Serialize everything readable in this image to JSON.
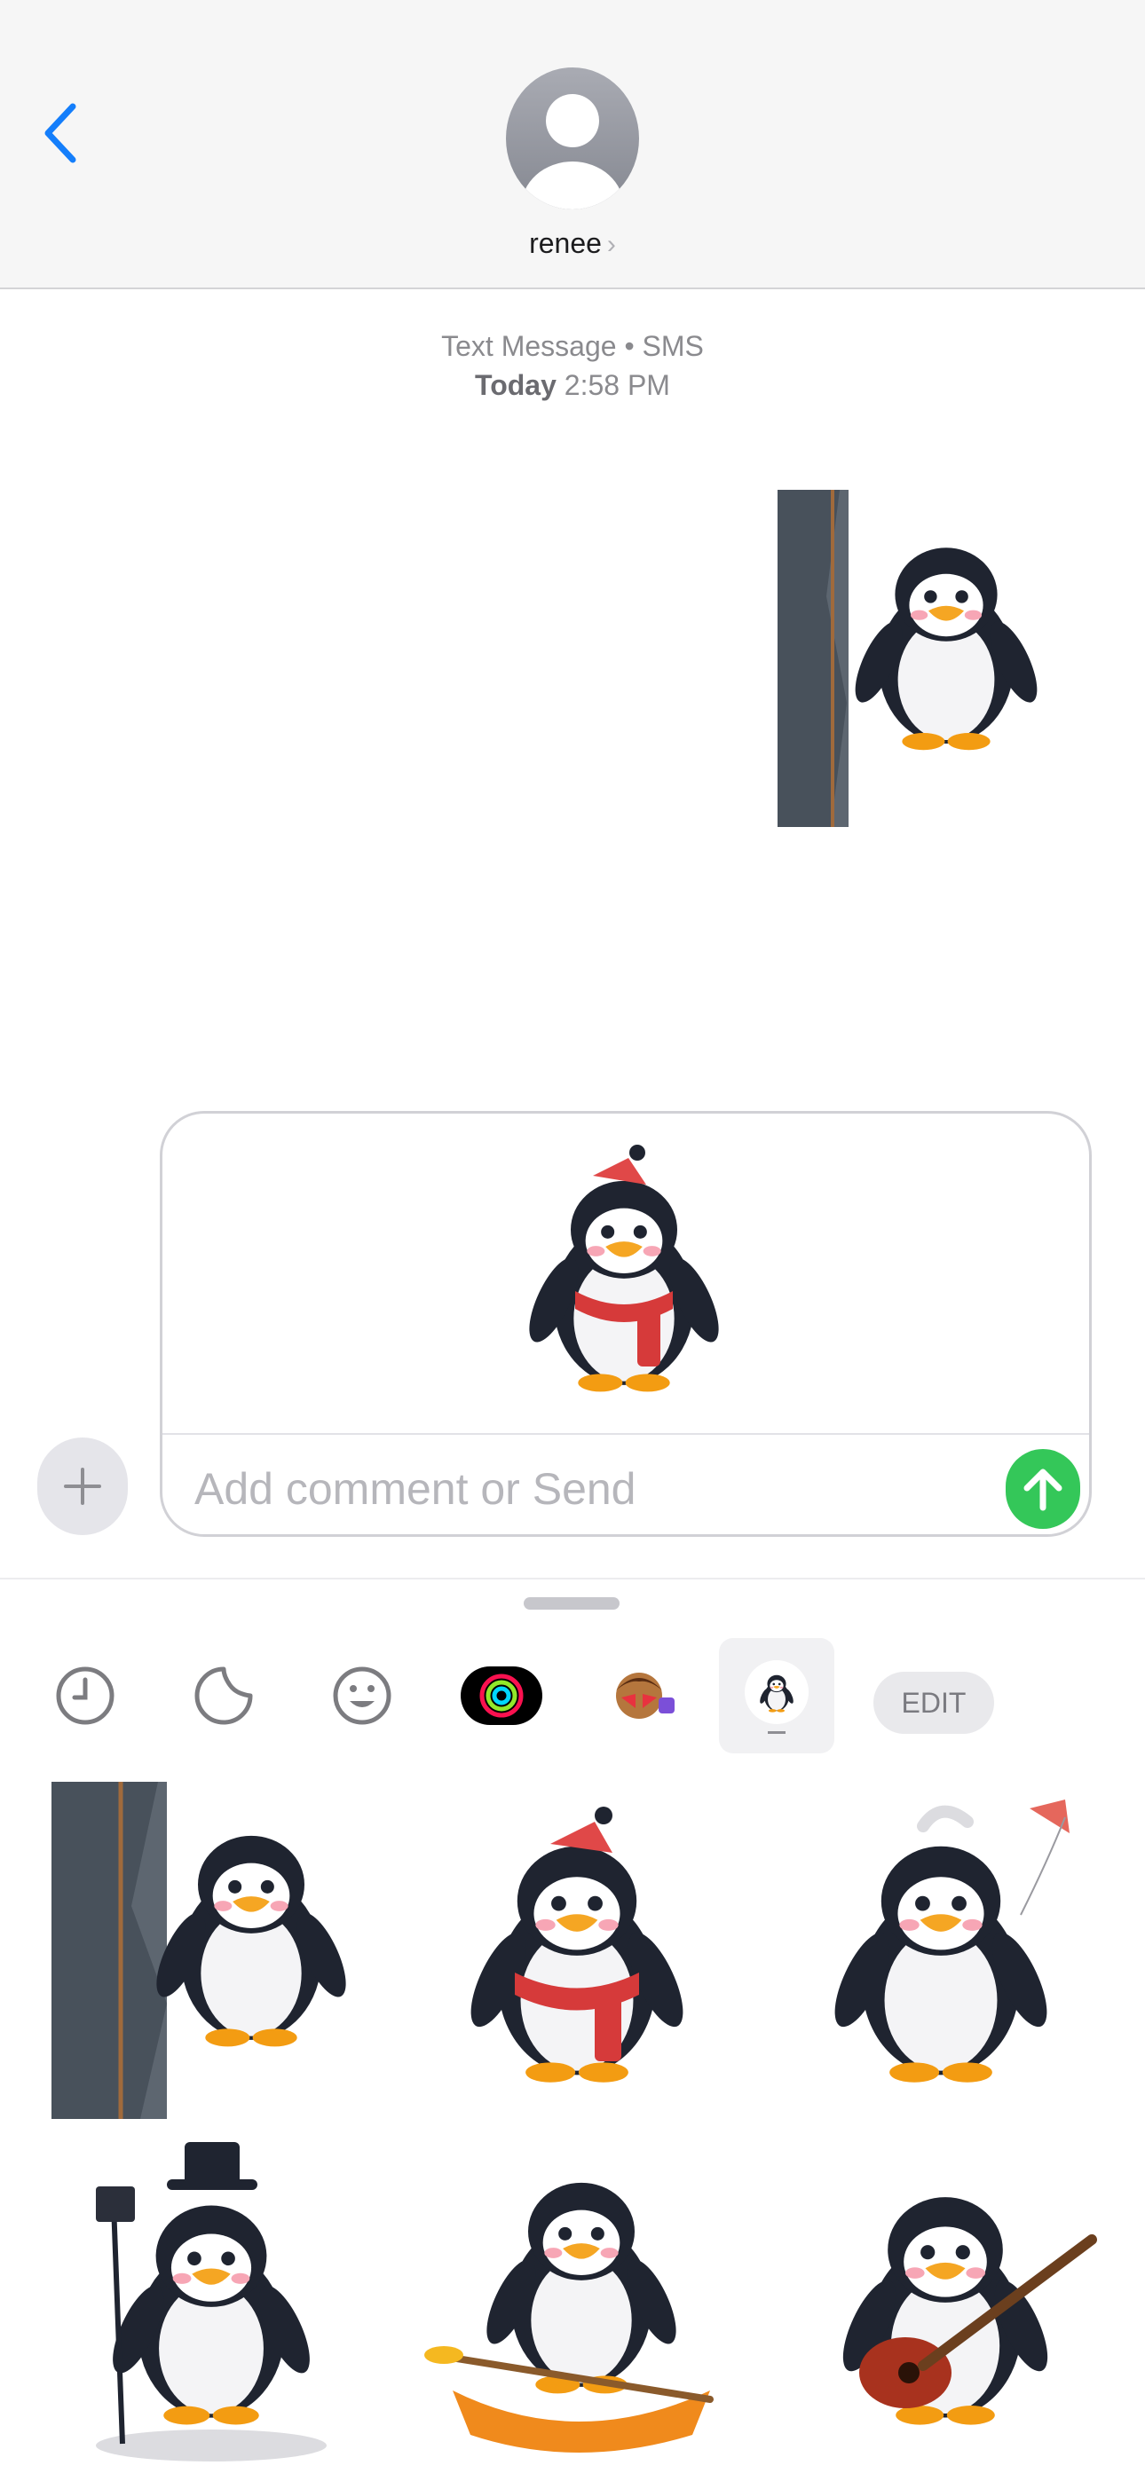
{
  "header": {
    "contact_name": "renee",
    "chevron": "›"
  },
  "thread": {
    "service_label": "Text Message • SMS",
    "day": "Today",
    "time": "2:58 PM"
  },
  "composer": {
    "placeholder": "Add comment or Send"
  },
  "drawer": {
    "tabs": [
      "recents-icon",
      "stickers-icon",
      "emoji-icon",
      "activity-icon",
      "memoji-icon",
      "penguin-sticker-pack-icon"
    ],
    "edit_label": "EDIT",
    "stickers": [
      "penguin-climbing-sticker",
      "penguin-scarf-sticker",
      "penguin-kite-sticker",
      "penguin-top-hat-sticker",
      "penguin-kayak-sticker",
      "penguin-guitar-sticker"
    ]
  },
  "colors": {
    "accent_blue": "#147efb",
    "send_green": "#34c759"
  }
}
